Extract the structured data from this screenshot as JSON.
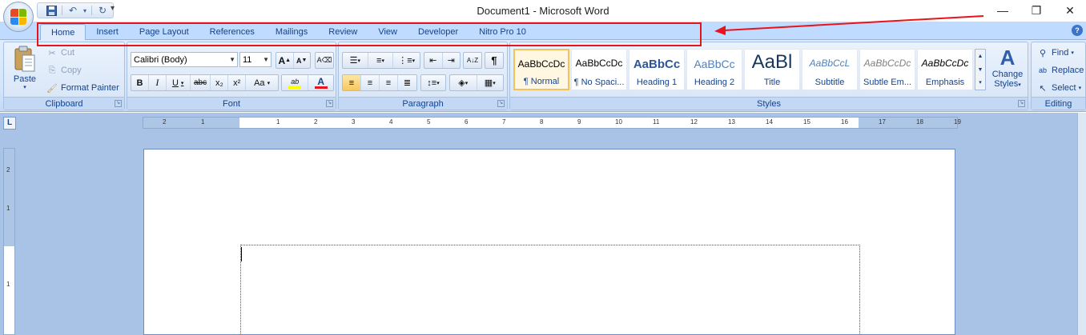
{
  "window": {
    "title": "Document1 - Microsoft Word",
    "minimize_glyph": "—",
    "restore_glyph": "❐",
    "close_glyph": "✕"
  },
  "quick_access": {
    "save_icon": "save-icon",
    "undo_icon": "undo-icon",
    "redo_icon": "redo-icon",
    "more_glyph": "▾"
  },
  "tabs": [
    {
      "label": "Home",
      "active": true
    },
    {
      "label": "Insert"
    },
    {
      "label": "Page Layout"
    },
    {
      "label": "References"
    },
    {
      "label": "Mailings"
    },
    {
      "label": "Review"
    },
    {
      "label": "View"
    },
    {
      "label": "Developer"
    },
    {
      "label": "Nitro Pro 10"
    }
  ],
  "annotation": {
    "box_color": "#e8141b"
  },
  "clipboard": {
    "group_label": "Clipboard",
    "paste_label": "Paste",
    "cut_label": "Cut",
    "copy_label": "Copy",
    "format_painter_label": "Format Painter"
  },
  "font": {
    "group_label": "Font",
    "font_name": "Calibri (Body)",
    "font_size": "11",
    "grow_label": "A",
    "shrink_label": "A",
    "bold": "B",
    "italic": "I",
    "underline": "U",
    "strike": "abc",
    "subscript": "x₂",
    "superscript": "x²",
    "change_case": "Aa",
    "highlight": "ab",
    "font_color": "A"
  },
  "paragraph": {
    "group_label": "Paragraph",
    "sort_glyph": "A↓Z",
    "show_marks_glyph": "¶"
  },
  "styles": {
    "group_label": "Styles",
    "tiles": [
      {
        "sample": "AaBbCcDc",
        "name": "¶ Normal",
        "selected": true
      },
      {
        "sample": "AaBbCcDc",
        "name": "¶ No Spaci..."
      },
      {
        "sample": "AaBbCc",
        "name": "Heading 1"
      },
      {
        "sample": "AaBbCc",
        "name": "Heading 2"
      },
      {
        "sample": "AaBl",
        "name": "Title"
      },
      {
        "sample": "AaBbCcL",
        "name": "Subtitle"
      },
      {
        "sample": "AaBbCcDc",
        "name": "Subtle Em..."
      },
      {
        "sample": "AaBbCcDc",
        "name": "Emphasis"
      }
    ],
    "change_styles_line1": "Change",
    "change_styles_line2": "Styles"
  },
  "editing": {
    "group_label": "Editing",
    "find_label": "Find",
    "replace_label": "Replace",
    "select_label": "Select"
  },
  "ruler": {
    "corner_glyph": "L",
    "h_ticks": [
      "2",
      "1",
      "1",
      "2",
      "3",
      "4",
      "5",
      "6",
      "7",
      "8",
      "9",
      "10",
      "11",
      "12",
      "13",
      "14",
      "15",
      "16",
      "17",
      "18",
      "19"
    ],
    "v_ticks": [
      "2",
      "1",
      "1"
    ]
  }
}
